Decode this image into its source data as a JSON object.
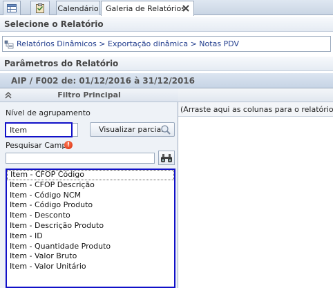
{
  "tabs": [
    {
      "label": "",
      "icon": "grid-icon"
    },
    {
      "label": "",
      "icon": "clipboard-icon"
    },
    {
      "label": "Calendário"
    },
    {
      "label": "Galeria de Relatórios",
      "active": true
    }
  ],
  "select_report": {
    "title": "Selecione o Relatório",
    "path": "Relatórios Dinâmicos > Exportação dinâmica > Notas PDV"
  },
  "params": {
    "title": "Parâmetros do Relatório"
  },
  "report_header": "AIP / F002 de: 01/12/2016 à 31/12/2016",
  "filter": {
    "title": "Filtro Principal",
    "group_label": "Nível de agrupamento",
    "group_value": "Item",
    "preview_button": "Visualizar parcial",
    "search_label": "Pesquisar Campo",
    "search_value": "",
    "fields": [
      "Item - CFOP Código",
      "Item - CFOP  Descrição",
      "Item - Código NCM",
      "Item - Código Produto",
      "Item - Desconto",
      "Item - Descrição Produto",
      "Item - ID",
      "Item - Quantidade Produto",
      "Item - Valor Bruto",
      "Item - Valor Unitário"
    ]
  },
  "drop_zone": {
    "hint": "(Arraste aqui as colunas para o relatório)"
  }
}
